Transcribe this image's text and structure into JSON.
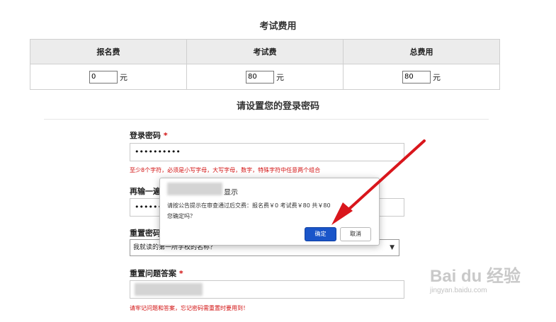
{
  "fees": {
    "section_title": "考试费用",
    "columns": [
      "报名费",
      "考试费",
      "总费用"
    ],
    "values": [
      "0",
      "80",
      "80"
    ],
    "unit": "元"
  },
  "password": {
    "section_title": "请设置您的登录密码",
    "login_label": "登录密码",
    "required_mark": "*",
    "login_value": "••••••••••",
    "login_hint": "至少8个字符，必须是小写字母，大写字母，数字，特殊字符中任意两个组合",
    "confirm_label": "再输一遍",
    "confirm_value": "••••••",
    "reset_question_label": "重置密码",
    "reset_question_value": "我就读的第一所学校的名称？",
    "reset_answer_label": "重置问题答案",
    "reset_answer_hint": "请牢记问题和答案，忘记密码需重置时要用到！"
  },
  "dialog": {
    "title_suffix": "显示",
    "message_line1": "请按公告提示在审查通过后交费：报名费￥0 考试费￥80 共￥80",
    "message_line2": "您确定吗？",
    "ok_label": "确定",
    "cancel_label": "取消"
  },
  "watermark": {
    "logo": "Bai du 经验",
    "url": "jingyan.baidu.com"
  },
  "colors": {
    "accent": "#1a55c9",
    "required": "#d21010",
    "arrow": "#d9161c"
  }
}
